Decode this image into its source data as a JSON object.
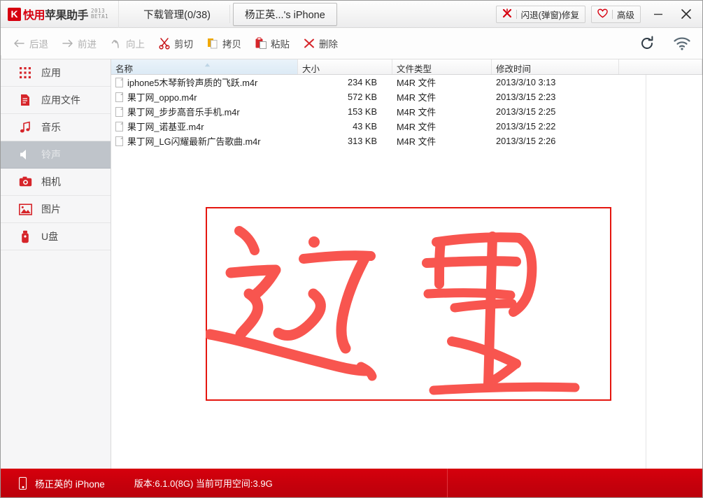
{
  "window": {
    "logo": {
      "mark": "K",
      "red_text": "快用",
      "dark_text": "苹果助手",
      "beta_line1": "2013",
      "beta_line2": "BETA1"
    },
    "tabs": [
      {
        "label": "下载管理(0/38)",
        "active": false
      },
      {
        "label": "杨正英...'s iPhone",
        "active": true
      }
    ],
    "pills": [
      {
        "icon": "crash-fix-icon",
        "label": "闪退(弹窗)修复"
      },
      {
        "icon": "heart-icon",
        "label": "高级"
      }
    ],
    "controls": [
      {
        "name": "minimize-button",
        "label": "—"
      },
      {
        "name": "close-button",
        "label": "✕"
      }
    ]
  },
  "toolbar": {
    "items": [
      {
        "icon": "back-arrow-icon",
        "label": "后退",
        "disabled": true
      },
      {
        "icon": "forward-arrow-icon",
        "label": "前进",
        "disabled": true
      },
      {
        "icon": "up-arrow-icon",
        "label": "向上",
        "disabled": true
      },
      {
        "icon": "scissors-icon",
        "label": "剪切",
        "disabled": false
      },
      {
        "icon": "copy-icon",
        "label": "拷贝",
        "disabled": false
      },
      {
        "icon": "paste-icon",
        "label": "粘贴",
        "disabled": false
      },
      {
        "icon": "delete-x-icon",
        "label": "删除",
        "disabled": false
      }
    ],
    "right_icons": [
      {
        "name": "refresh-icon"
      },
      {
        "name": "wifi-icon"
      }
    ]
  },
  "sidebar": {
    "items": [
      {
        "icon": "apps-grid-icon",
        "label": "应用",
        "selected": false
      },
      {
        "icon": "document-icon",
        "label": "应用文件",
        "selected": false
      },
      {
        "icon": "music-note-icon",
        "label": "音乐",
        "selected": false
      },
      {
        "icon": "speaker-icon",
        "label": "铃声",
        "selected": true
      },
      {
        "icon": "camera-icon",
        "label": "相机",
        "selected": false
      },
      {
        "icon": "picture-icon",
        "label": "图片",
        "selected": false
      },
      {
        "icon": "usb-drive-icon",
        "label": "U盘",
        "selected": false
      }
    ]
  },
  "filelist": {
    "columns": [
      {
        "key": "name",
        "label": "名称",
        "sorted": true
      },
      {
        "key": "size",
        "label": "大小",
        "sorted": false
      },
      {
        "key": "type",
        "label": "文件类型",
        "sorted": false
      },
      {
        "key": "time",
        "label": "修改时间",
        "sorted": false
      }
    ],
    "rows": [
      {
        "name": "iphone5木琴新铃声质的飞跃.m4r",
        "size": "234 KB",
        "type": "M4R 文件",
        "time": "2013/3/10 3:13"
      },
      {
        "name": "果丁网_oppo.m4r",
        "size": "572 KB",
        "type": "M4R 文件",
        "time": "2013/3/15 2:23"
      },
      {
        "name": "果丁网_步步高音乐手机.m4r",
        "size": "153 KB",
        "type": "M4R 文件",
        "time": "2013/3/15 2:25"
      },
      {
        "name": "果丁网_诺基亚.m4r",
        "size": "43 KB",
        "type": "M4R 文件",
        "time": "2013/3/15 2:22"
      },
      {
        "name": "果丁网_LG闪耀最新广告歌曲.m4r",
        "size": "313 KB",
        "type": "M4R 文件",
        "time": "2013/3/15 2:26"
      }
    ]
  },
  "annotation": {
    "name": "handwritten-annotation",
    "text": "这里",
    "color": "#f8554f",
    "box_color": "#e5160f"
  },
  "statusbar": {
    "device_icon": "iphone-icon",
    "device_name": "杨正英的 iPhone",
    "version_info": "版本:6.1.0(8G) 当前可用空间:3.9G"
  },
  "colors": {
    "brand_red": "#c7000c",
    "accent_red": "#d6000f",
    "selected_gray": "#bfc4ca"
  }
}
